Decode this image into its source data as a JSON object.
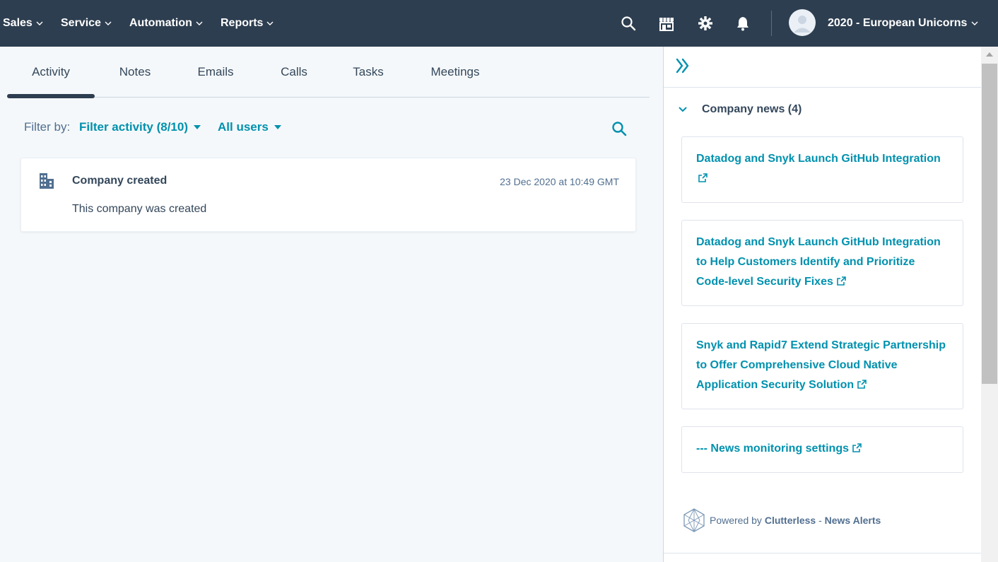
{
  "nav": {
    "items": [
      {
        "label": "Sales"
      },
      {
        "label": "Service"
      },
      {
        "label": "Automation"
      },
      {
        "label": "Reports"
      }
    ],
    "icons": [
      "search-icon",
      "marketplace-icon",
      "gear-icon",
      "bell-icon"
    ],
    "account_name": "2020 - European Unicorns"
  },
  "tabs": [
    {
      "label": "Activity",
      "active": true
    },
    {
      "label": "Notes"
    },
    {
      "label": "Emails"
    },
    {
      "label": "Calls"
    },
    {
      "label": "Tasks"
    },
    {
      "label": "Meetings"
    }
  ],
  "filter": {
    "label": "Filter by:",
    "activity": "Filter activity (8/10)",
    "users": "All users"
  },
  "activity": {
    "title": "Company created",
    "timestamp": "23 Dec 2020 at 10:49 GMT",
    "body": "This company was created"
  },
  "sidebar": {
    "section_title": "Company news (4)",
    "news": [
      {
        "lines": [
          "Datadog and Snyk Launch GitHub Integration"
        ]
      },
      {
        "lines": [
          "Datadog and Snyk Launch GitHub Integration",
          "to Help Customers Identify and Prioritize",
          "Code-level Security Fixes"
        ]
      },
      {
        "lines": [
          "Snyk and Rapid7 Extend Strategic Partnership",
          "to Offer Comprehensive Cloud Native",
          "Application Security Solution"
        ]
      },
      {
        "lines": [
          "--- News monitoring settings"
        ]
      }
    ],
    "powered_prefix": "Powered by",
    "powered_brand": "Clutterless",
    "powered_sep": "-",
    "powered_product": "News Alerts"
  },
  "colors": {
    "nav_bg": "#2d3e50",
    "link": "#0091ae",
    "text": "#33475b",
    "muted": "#516f90",
    "page_bg": "#f5f8fa"
  }
}
